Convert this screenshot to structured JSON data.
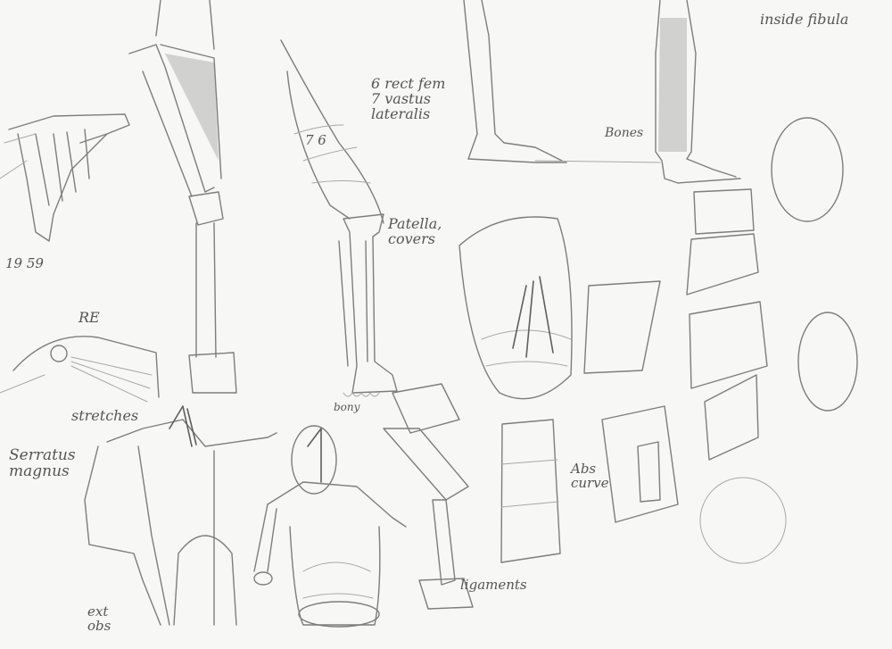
{
  "notes": {
    "top_right": "inside fibula",
    "rect_fem": "6 rect fem\n7 vastus\nlateralis",
    "numbers_76": "7 6",
    "bones": "Bones",
    "patella": "Patella,\ncovers",
    "n1959": "19 59",
    "re": "RE",
    "stretches": "stretches",
    "serratus": "Serratus\nmagnus",
    "abs_curve": "Abs\ncurve",
    "ligaments": "ligaments",
    "ext_obs": "ext\nobs",
    "bony": "bony"
  },
  "colors": {
    "paper": "#f7f7f5",
    "graphite": "#7d7d7d"
  }
}
